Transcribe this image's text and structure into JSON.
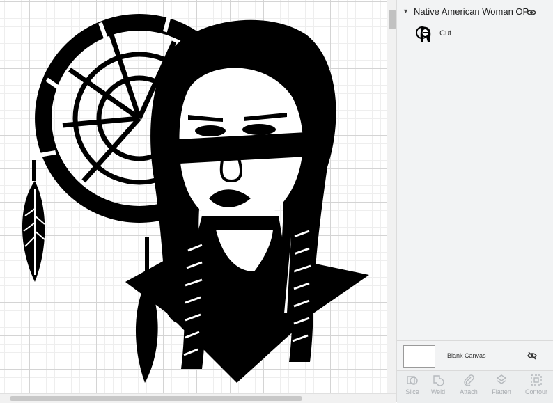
{
  "layers_panel": {
    "group_name": "Native American Woman OP...",
    "group_icon": "eye-icon",
    "layer": {
      "label": "Cut",
      "thumbnail": "woman-dreamcatcher-thumbnail"
    },
    "blank_canvas_label": "Blank Canvas",
    "blank_canvas_icon": "eye-hidden-icon"
  },
  "toolbar": {
    "slice": "Slice",
    "weld": "Weld",
    "attach": "Attach",
    "flatten": "Flatten",
    "contour": "Contour"
  },
  "colors": {
    "art": "#000000",
    "panel_bg": "#f2f3f4",
    "disabled_text": "#a9adb1"
  }
}
